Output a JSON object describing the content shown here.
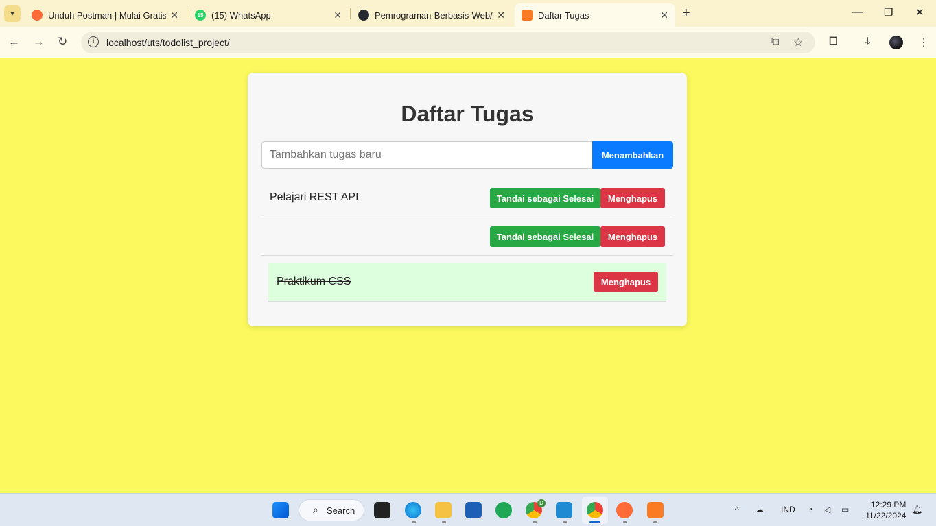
{
  "browser": {
    "tabs": [
      {
        "title": "Unduh Postman | Mulai Gratis",
        "favicon_color": "#ff6c37"
      },
      {
        "title": "(15) WhatsApp",
        "favicon_color": "#25d366",
        "badge": "15"
      },
      {
        "title": "Pemrograman-Berbasis-Web/PE",
        "favicon_color": "#24292f"
      },
      {
        "title": "Daftar Tugas",
        "favicon_color": "#fb7a24",
        "active": true
      }
    ],
    "url": "localhost/uts/todolist_project/"
  },
  "app": {
    "title": "Daftar Tugas",
    "input_placeholder": "Tambahkan tugas baru",
    "add_label": "Menambahkan",
    "tasks": [
      {
        "text": "Pelajari REST API",
        "done": false,
        "done_label": "Tandai sebagai Selesai",
        "delete_label": "Menghapus"
      },
      {
        "text": "",
        "done": false,
        "done_label": "Tandai sebagai Selesai",
        "delete_label": "Menghapus"
      },
      {
        "text": "Praktikum CSS",
        "done": true,
        "delete_label": "Menghapus"
      }
    ]
  },
  "taskbar": {
    "search_label": "Search",
    "language": "IND",
    "time": "12:29 PM",
    "date": "11/22/2024",
    "chrome_badge": "D"
  },
  "colors": {
    "page_bg": "#fbf95e",
    "primary": "#0a7bff",
    "success": "#28a745",
    "danger": "#dc3545",
    "done_row": "#ddffde"
  }
}
